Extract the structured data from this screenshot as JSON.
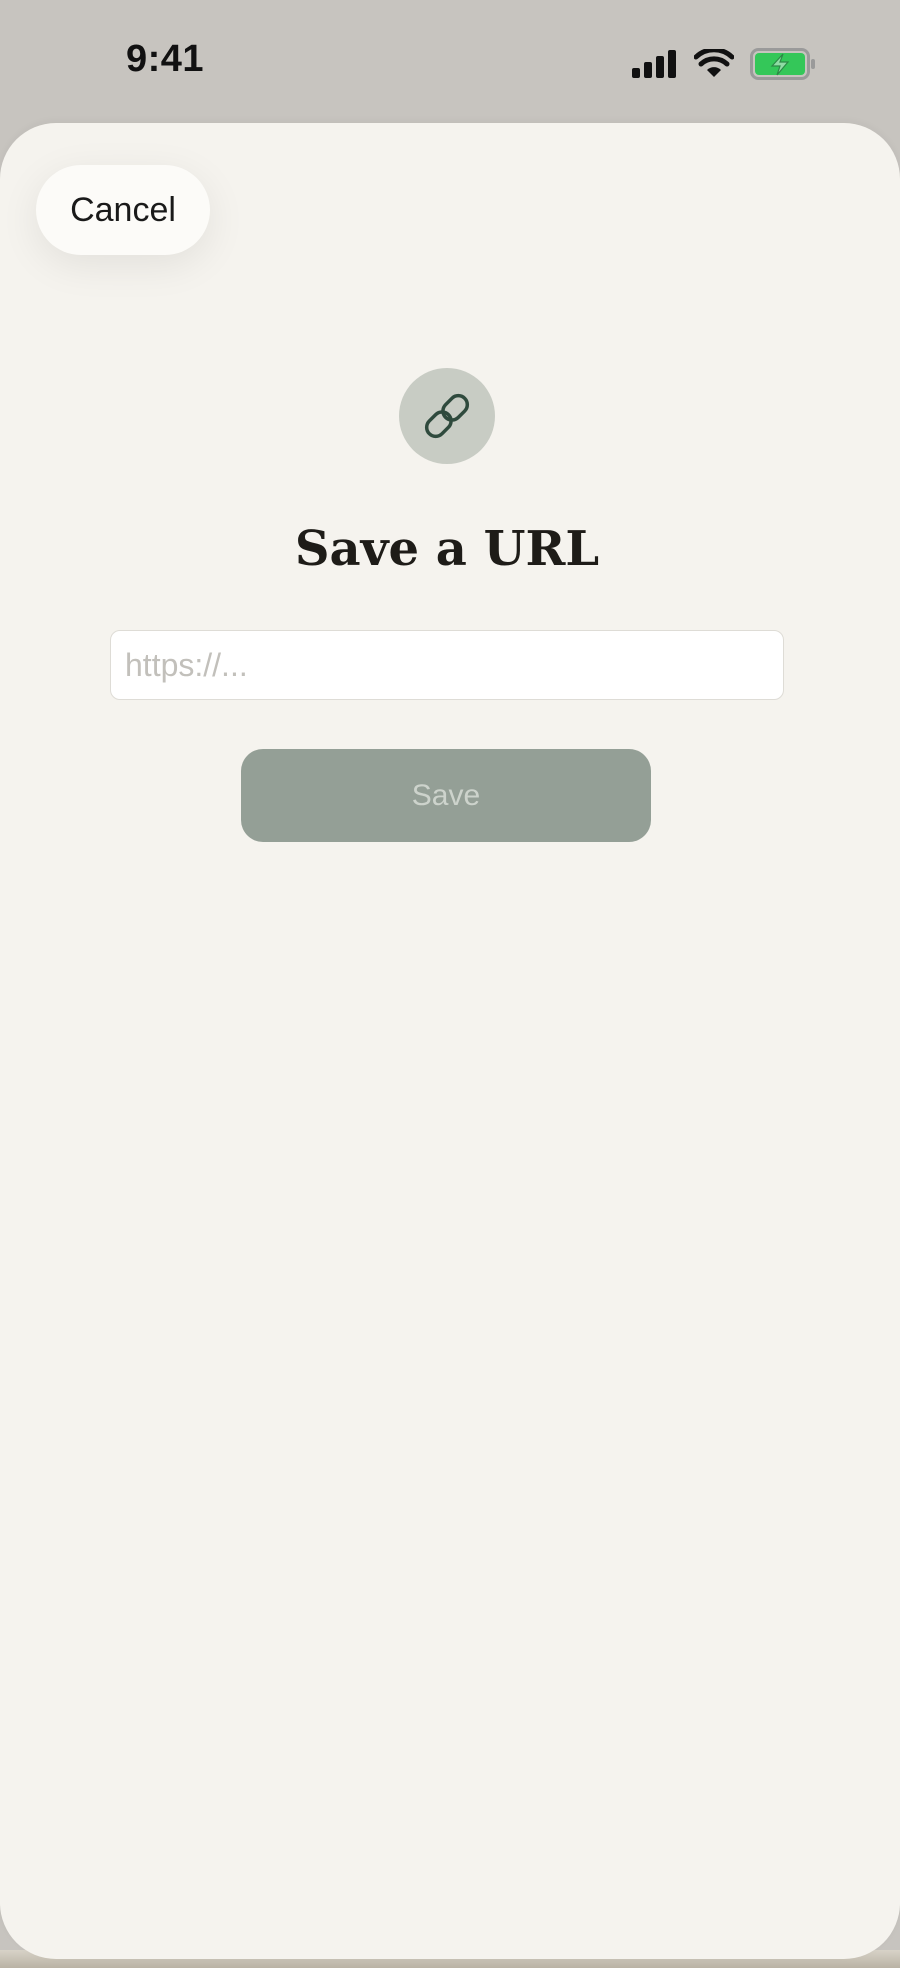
{
  "status_bar": {
    "time": "9:41",
    "icons": [
      "cellular-signal-icon",
      "wifi-icon",
      "battery-charging-icon"
    ],
    "battery_color": "#34c759"
  },
  "sheet": {
    "cancel_label": "Cancel",
    "badge_icon": "link-icon",
    "title": "Save a URL",
    "url_input": {
      "value": "",
      "placeholder": "https://..."
    },
    "save_label": "Save",
    "save_enabled": false
  },
  "colors": {
    "sheet_background": "#f5f3ee",
    "badge_background": "#c8ccc4",
    "icon_stroke": "#2f4a3d",
    "save_button": "#949f96",
    "save_text": "#cdd3cc",
    "title": "#1e1c18"
  }
}
